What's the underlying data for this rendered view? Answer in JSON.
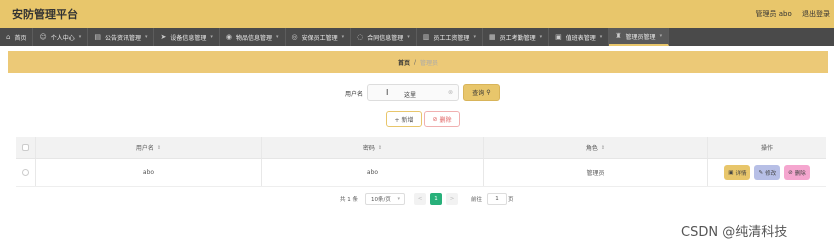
{
  "header": {
    "title": "安防管理平台",
    "user_label": "管理员 abo",
    "logout": "退出登录"
  },
  "nav": [
    {
      "label": "首页",
      "icon": "home-icon",
      "glyph": "⌂",
      "chev": false
    },
    {
      "label": "个人中心",
      "icon": "user-icon",
      "glyph": "☺",
      "chev": true
    },
    {
      "label": "公告资讯管理",
      "icon": "news-icon",
      "glyph": "▤",
      "chev": true
    },
    {
      "label": "设备信息管理",
      "icon": "send-icon",
      "glyph": "➤",
      "chev": true
    },
    {
      "label": "物品信息管理",
      "icon": "location-icon",
      "glyph": "◉",
      "chev": true
    },
    {
      "label": "安保员工管理",
      "icon": "staff-icon",
      "glyph": "◎",
      "chev": true
    },
    {
      "label": "合同信息管理",
      "icon": "contract-icon",
      "glyph": "◌",
      "chev": true
    },
    {
      "label": "员工工资管理",
      "icon": "wage-icon",
      "glyph": "▥",
      "chev": true
    },
    {
      "label": "员工考勤管理",
      "icon": "attendance-icon",
      "glyph": "▦",
      "chev": true
    },
    {
      "label": "值班表管理",
      "icon": "schedule-icon",
      "glyph": "▣",
      "chev": true
    },
    {
      "label": "管理员管理",
      "icon": "admin-icon",
      "glyph": "♜",
      "chev": true,
      "active": true
    }
  ],
  "breadcrumb": {
    "home": "首页",
    "sep": "/",
    "current": "管理员"
  },
  "search": {
    "label": "用户名",
    "value": "这里",
    "button": "查询",
    "button_icon": "search-icon"
  },
  "actions": {
    "add": "+ 新增",
    "delete": "删除"
  },
  "table": {
    "headers": {
      "username": "用户名",
      "password": "密码",
      "role": "角色",
      "operation": "操作"
    },
    "rows": [
      {
        "username": "abo",
        "password": "abo",
        "role": "管理员"
      }
    ],
    "op_buttons": {
      "detail": "详情",
      "edit": "修改",
      "delete": "删除"
    }
  },
  "pager": {
    "total": "共 1 条",
    "page_size": "10条/页",
    "prev": "<",
    "current": "1",
    "next": ">",
    "goto": "前往",
    "goto_value": "1",
    "page_unit": "页"
  },
  "watermark": "CSDN @纯清科技",
  "colors": {
    "header_bg": "#e8c66b",
    "nav_bg": "#4a4a4a",
    "pager_active": "#28b07a"
  }
}
